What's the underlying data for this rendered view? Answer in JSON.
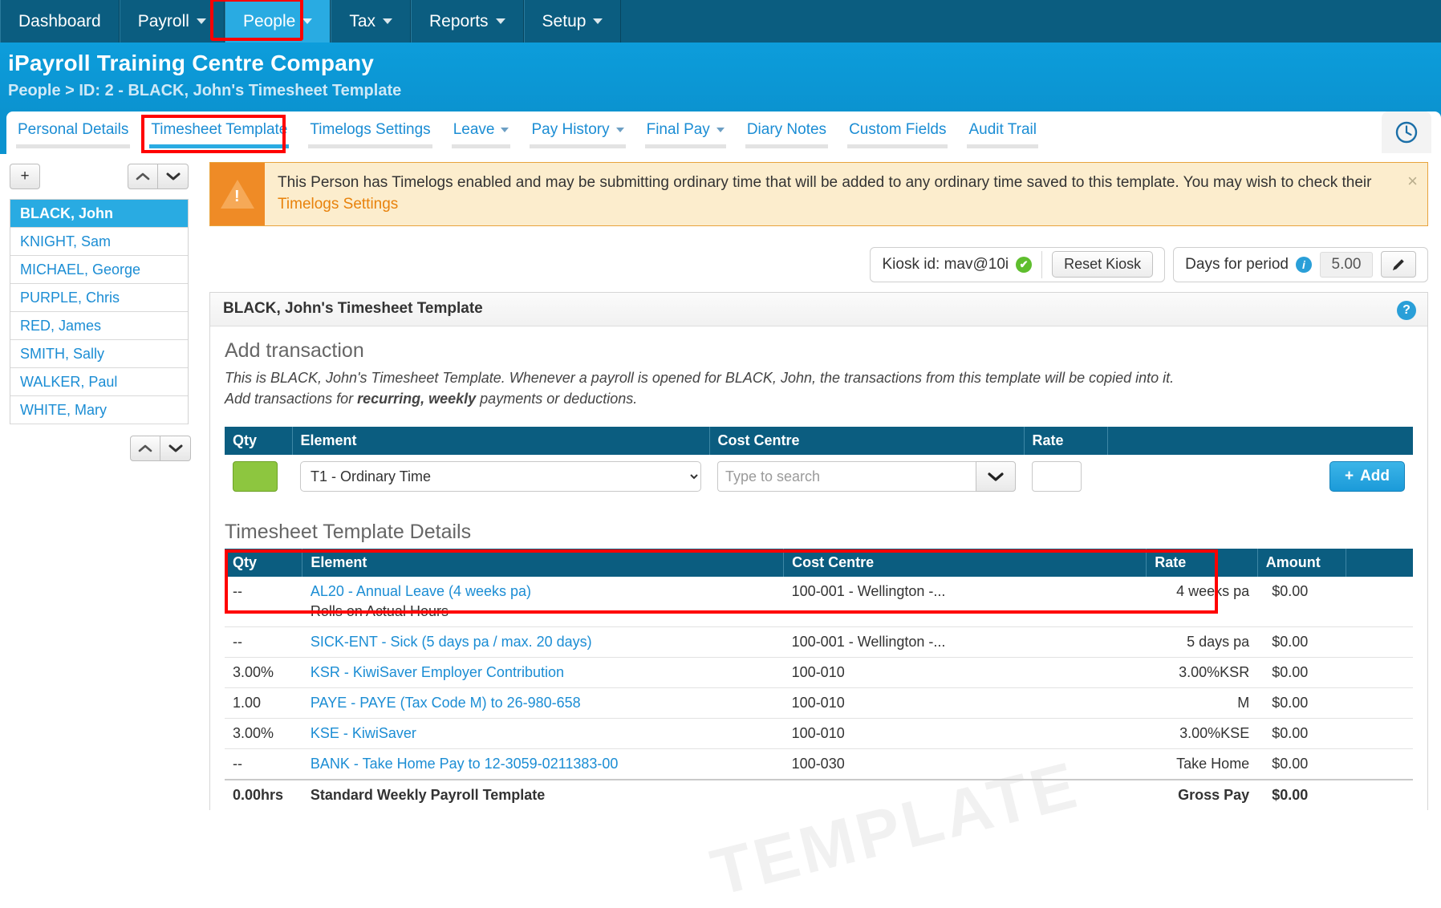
{
  "topnav": {
    "items": [
      {
        "label": "Dashboard",
        "caret": false,
        "active": false
      },
      {
        "label": "Payroll",
        "caret": true,
        "active": false
      },
      {
        "label": "People",
        "caret": true,
        "active": true
      },
      {
        "label": "Tax",
        "caret": true,
        "active": false
      },
      {
        "label": "Reports",
        "caret": true,
        "active": false
      },
      {
        "label": "Setup",
        "caret": true,
        "active": false
      }
    ],
    "highlight_color": "#ff0000",
    "active_color": "#29abe2"
  },
  "header": {
    "company": "iPayroll Training Centre Company",
    "breadcrumb": "People > ID: 2 - BLACK, John's Timesheet Template"
  },
  "tabs": [
    {
      "label": "Personal Details",
      "caret": false,
      "active": false
    },
    {
      "label": "Timesheet Template",
      "caret": false,
      "active": true
    },
    {
      "label": "Timelogs Settings",
      "caret": false,
      "active": false
    },
    {
      "label": "Leave",
      "caret": true,
      "active": false
    },
    {
      "label": "Pay History",
      "caret": true,
      "active": false
    },
    {
      "label": "Final Pay",
      "caret": true,
      "active": false
    },
    {
      "label": "Diary Notes",
      "caret": false,
      "active": false
    },
    {
      "label": "Custom Fields",
      "caret": false,
      "active": false
    },
    {
      "label": "Audit Trail",
      "caret": false,
      "active": false
    }
  ],
  "sidebar": {
    "add_label": "+",
    "up_label": "▲",
    "down_label": "▼",
    "people": [
      {
        "name": "BLACK, John",
        "selected": true
      },
      {
        "name": "KNIGHT, Sam",
        "selected": false
      },
      {
        "name": "MICHAEL, George",
        "selected": false
      },
      {
        "name": "PURPLE, Chris",
        "selected": false
      },
      {
        "name": "RED, James",
        "selected": false
      },
      {
        "name": "SMITH, Sally",
        "selected": false
      },
      {
        "name": "WALKER, Paul",
        "selected": false
      },
      {
        "name": "WHITE, Mary",
        "selected": false
      }
    ]
  },
  "alert": {
    "text_before": "This Person has Timelogs enabled and may be submitting ordinary time that will be added to any ordinary time saved to this template. You may wish to check their ",
    "link": "Timelogs Settings",
    "close": "×"
  },
  "kiosk": {
    "label": "Kiosk id: mav@10i",
    "status_icon": "✔",
    "reset_label": "Reset Kiosk",
    "days_label": "Days for period",
    "days_value": "5.00",
    "edit_icon": "pencil-icon"
  },
  "panel": {
    "title": "BLACK, John's Timesheet Template",
    "help": "?",
    "section_title": "Add transaction",
    "desc_line1": "This is BLACK, John's Timesheet Template. Whenever a payroll is opened for BLACK, John, the transactions from this template will be copied into it.",
    "desc_line2_a": "Add transactions for ",
    "desc_line2_b": "recurring, weekly",
    "desc_line2_c": " payments or deductions."
  },
  "add_table": {
    "headers": [
      "Qty",
      "Element",
      "Cost Centre",
      "Rate",
      ""
    ],
    "element_value": "T1 - Ordinary Time",
    "element_options": [
      "T1 - Ordinary Time"
    ],
    "cost_centre_placeholder": "Type to search",
    "cost_centre_value": "",
    "rate_value": "",
    "add_label": "Add",
    "add_plus": "+",
    "qty_value": ""
  },
  "details": {
    "title": "Timesheet Template Details",
    "headers": [
      "Qty",
      "Element",
      "Cost Centre",
      "Rate",
      "Amount",
      ""
    ],
    "rows": [
      {
        "qty": "--",
        "element": "AL20 - Annual Leave (4 weeks pa)",
        "sub": "Rolls on Actual Hours",
        "cost_centre": "100-001 - Wellington -...",
        "rate": "4 weeks pa",
        "amount": "$0.00",
        "highlighted": true
      },
      {
        "qty": "--",
        "element": "SICK-ENT - Sick (5 days pa / max. 20 days)",
        "sub": "",
        "cost_centre": "100-001 - Wellington -...",
        "rate": "5 days pa",
        "amount": "$0.00",
        "highlighted": true
      },
      {
        "qty": "3.00%",
        "element": "KSR - KiwiSaver Employer Contribution",
        "sub": "",
        "cost_centre": "100-010",
        "rate": "3.00%KSR",
        "amount": "$0.00",
        "highlighted": false
      },
      {
        "qty": "1.00",
        "element": "PAYE - PAYE (Tax Code M) to 26-980-658",
        "sub": "",
        "cost_centre": "100-010",
        "rate": "M",
        "amount": "$0.00",
        "highlighted": false
      },
      {
        "qty": "3.00%",
        "element": "KSE - KiwiSaver",
        "sub": "",
        "cost_centre": "100-010",
        "rate": "3.00%KSE",
        "amount": "$0.00",
        "highlighted": false
      },
      {
        "qty": "--",
        "element": "BANK - Take Home Pay to 12-3059-0211383-00",
        "sub": "",
        "cost_centre": "100-030",
        "rate": "Take Home",
        "amount": "$0.00",
        "highlighted": false
      }
    ],
    "total": {
      "qty": "0.00hrs",
      "element": "Standard Weekly Payroll Template",
      "cost_centre": "",
      "rate": "Gross Pay",
      "amount": "$0.00"
    }
  },
  "watermark": "TEMPLATE"
}
